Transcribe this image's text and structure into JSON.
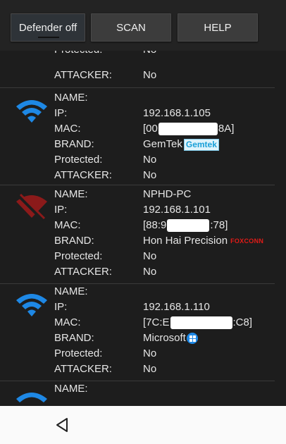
{
  "toolbar": {
    "defender_label": "Defender off",
    "scan_label": "SCAN",
    "help_label": "HELP"
  },
  "labels": {
    "name": "NAME:",
    "ip": "IP:",
    "mac": "MAC:",
    "brand": "BRAND:",
    "protected": "Protected:",
    "attacker": "ATTACKER:"
  },
  "partial_top": {
    "protected": "No",
    "attacker": "No"
  },
  "devices": [
    {
      "wifi_icon": "wifi-icon",
      "icon_color": "#1e88e5",
      "name": "",
      "ip": "192.168.1.105",
      "mac_start": "[00",
      "mac_end": "8A]",
      "brand": "GemTek",
      "brand_logo": "Gemtek",
      "protected": "No",
      "attacker": "No"
    },
    {
      "wifi_icon": "wifi-off-icon",
      "icon_color": "#8b1a1a",
      "name": "NPHD-PC",
      "ip": "192.168.1.101",
      "mac_start": "[88:9",
      "mac_end": ":78]",
      "brand": "Hon Hai Precision",
      "brand_logo": "FOXCONN",
      "protected": "No",
      "attacker": "No"
    },
    {
      "wifi_icon": "wifi-icon",
      "icon_color": "#1e88e5",
      "name": "",
      "ip": "192.168.1.110",
      "mac_start": "[7C:E",
      "mac_end": ":C8]",
      "brand": "Microsoft",
      "brand_logo": "windows-logo-icon",
      "protected": "No",
      "attacker": "No"
    }
  ],
  "partial_bottom": {
    "name": ""
  },
  "nav": {
    "back_icon": "back-triangle-icon"
  }
}
